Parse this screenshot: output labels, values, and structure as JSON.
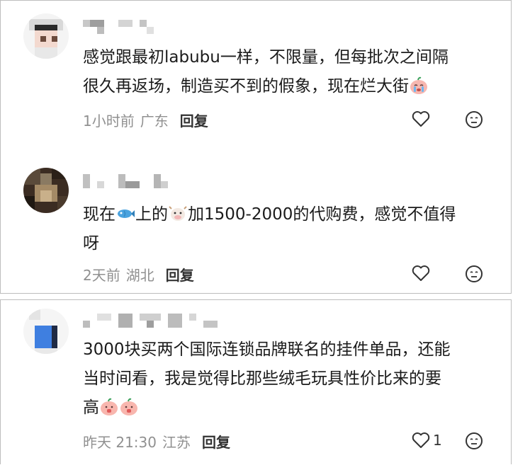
{
  "comments": [
    {
      "line1": "感觉跟最初labubu一样，不限量，但每批次之间隔",
      "line2": "很久再返场，制造买不到的假象，现在烂大街",
      "time": "1小时前",
      "location": "广东",
      "reply_label": "回复",
      "like_count": ""
    },
    {
      "line1_a": "现在",
      "line1_b": "上的",
      "line1_c": "加1500-2000的代购费，感觉不值得",
      "line2": "呀",
      "time": "2天前",
      "location": "湖北",
      "reply_label": "回复",
      "like_count": ""
    },
    {
      "line1": "3000块买两个国际连锁品牌联名的挂件单品，还能",
      "line2": "当时间看，我是觉得比那些绒毛玩具性价比来的要",
      "line3": "高",
      "time": "昨天 21:30",
      "location": "江苏",
      "reply_label": "回复",
      "like_count": "1"
    }
  ],
  "icons": {
    "heart": "heart-outline-icon",
    "emoji": "neutral-face-icon",
    "fish": "fish-emoji-icon",
    "cow": "cow-emoji-icon",
    "crying": "crying-face-icon",
    "peach": "peach-face-icon"
  },
  "colors": {
    "text": "#1b1b1b",
    "meta": "#909090",
    "reply": "#333333",
    "border": "#bdbdbd"
  }
}
